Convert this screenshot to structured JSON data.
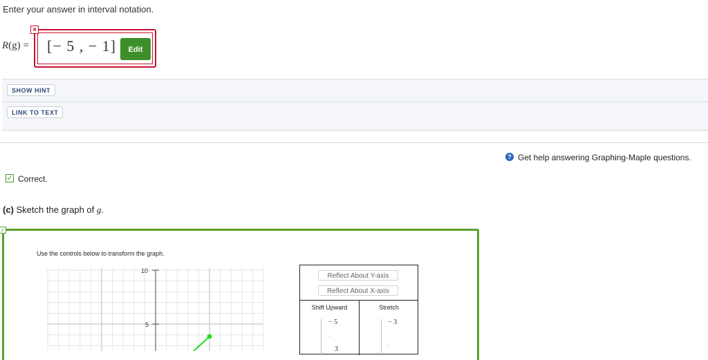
{
  "question": {
    "instruction": "Enter your answer in interval notation.",
    "label_func": "R",
    "label_arg": "(g)",
    "label_eq": "=",
    "answer": "[− 5 , − 1]",
    "incorrect_mark": "×",
    "edit_label": "Edit"
  },
  "toolbar": {
    "hint_label": "SHOW HINT",
    "link_label": "LINK TO TEXT"
  },
  "help": {
    "icon": "?",
    "text": "Get help answering Graphing-Maple questions."
  },
  "feedback": {
    "check": "✓",
    "text": "Correct."
  },
  "part_c": {
    "label": "(c)",
    "text": "Sketch the graph of",
    "var": "g",
    "end": "."
  },
  "graph": {
    "instruction": "Use the controls below to transform the graph.",
    "y_tick_labels": [
      "10",
      "5"
    ],
    "line_color": "#22dd22"
  },
  "controls": {
    "reflect_y": "Reflect About Y-axis",
    "reflect_x": "Reflect About X-axis",
    "shift_upward": "Shift Upward",
    "stretch": "Stretch",
    "shift_top_value": "− 5",
    "stretch_top_value": "− 3",
    "shift_next_value": "3"
  }
}
